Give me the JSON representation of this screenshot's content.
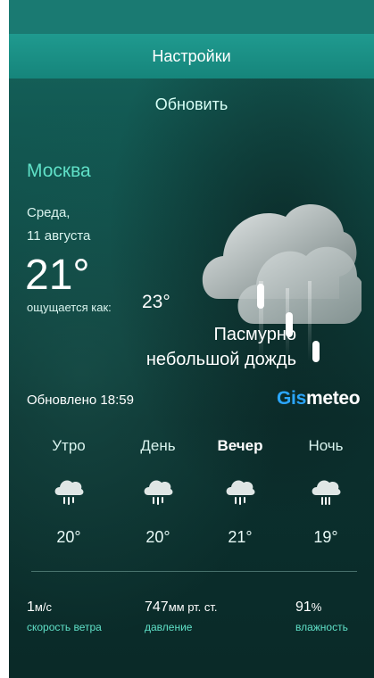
{
  "header": {
    "settings_label": "Настройки",
    "refresh_label": "Обновить"
  },
  "current": {
    "city": "Москва",
    "day": "Среда,",
    "date": "11 августа",
    "temperature": "21°",
    "feels_like_label": "ощущается как:",
    "feels_like_value": "23°",
    "condition_line1": "Пасмурно",
    "condition_line2": "небольшой дождь",
    "updated": "Обновлено 18:59"
  },
  "branding": {
    "logo_part1": "Gis",
    "logo_part2": "meteo"
  },
  "forecast": [
    {
      "label": "Утро",
      "temp": "20°",
      "icon": "rain-cloud-icon"
    },
    {
      "label": "День",
      "temp": "20°",
      "icon": "rain-cloud-icon"
    },
    {
      "label": "Вечер",
      "temp": "21°",
      "icon": "rain-cloud-icon"
    },
    {
      "label": "Ночь",
      "temp": "19°",
      "icon": "rain-cloud-icon"
    }
  ],
  "stats": {
    "wind": {
      "value": "1",
      "unit": "м/с",
      "caption": "скорость ветра"
    },
    "pressure": {
      "value": "747",
      "unit": "мм рт. ст.",
      "caption": "давление"
    },
    "humidity": {
      "value": "91",
      "unit": "%",
      "caption": "влажность"
    }
  },
  "colors": {
    "accent": "#5fe0c7",
    "brand_blue": "#2ba6ff",
    "bar": "#1f9a8f"
  }
}
